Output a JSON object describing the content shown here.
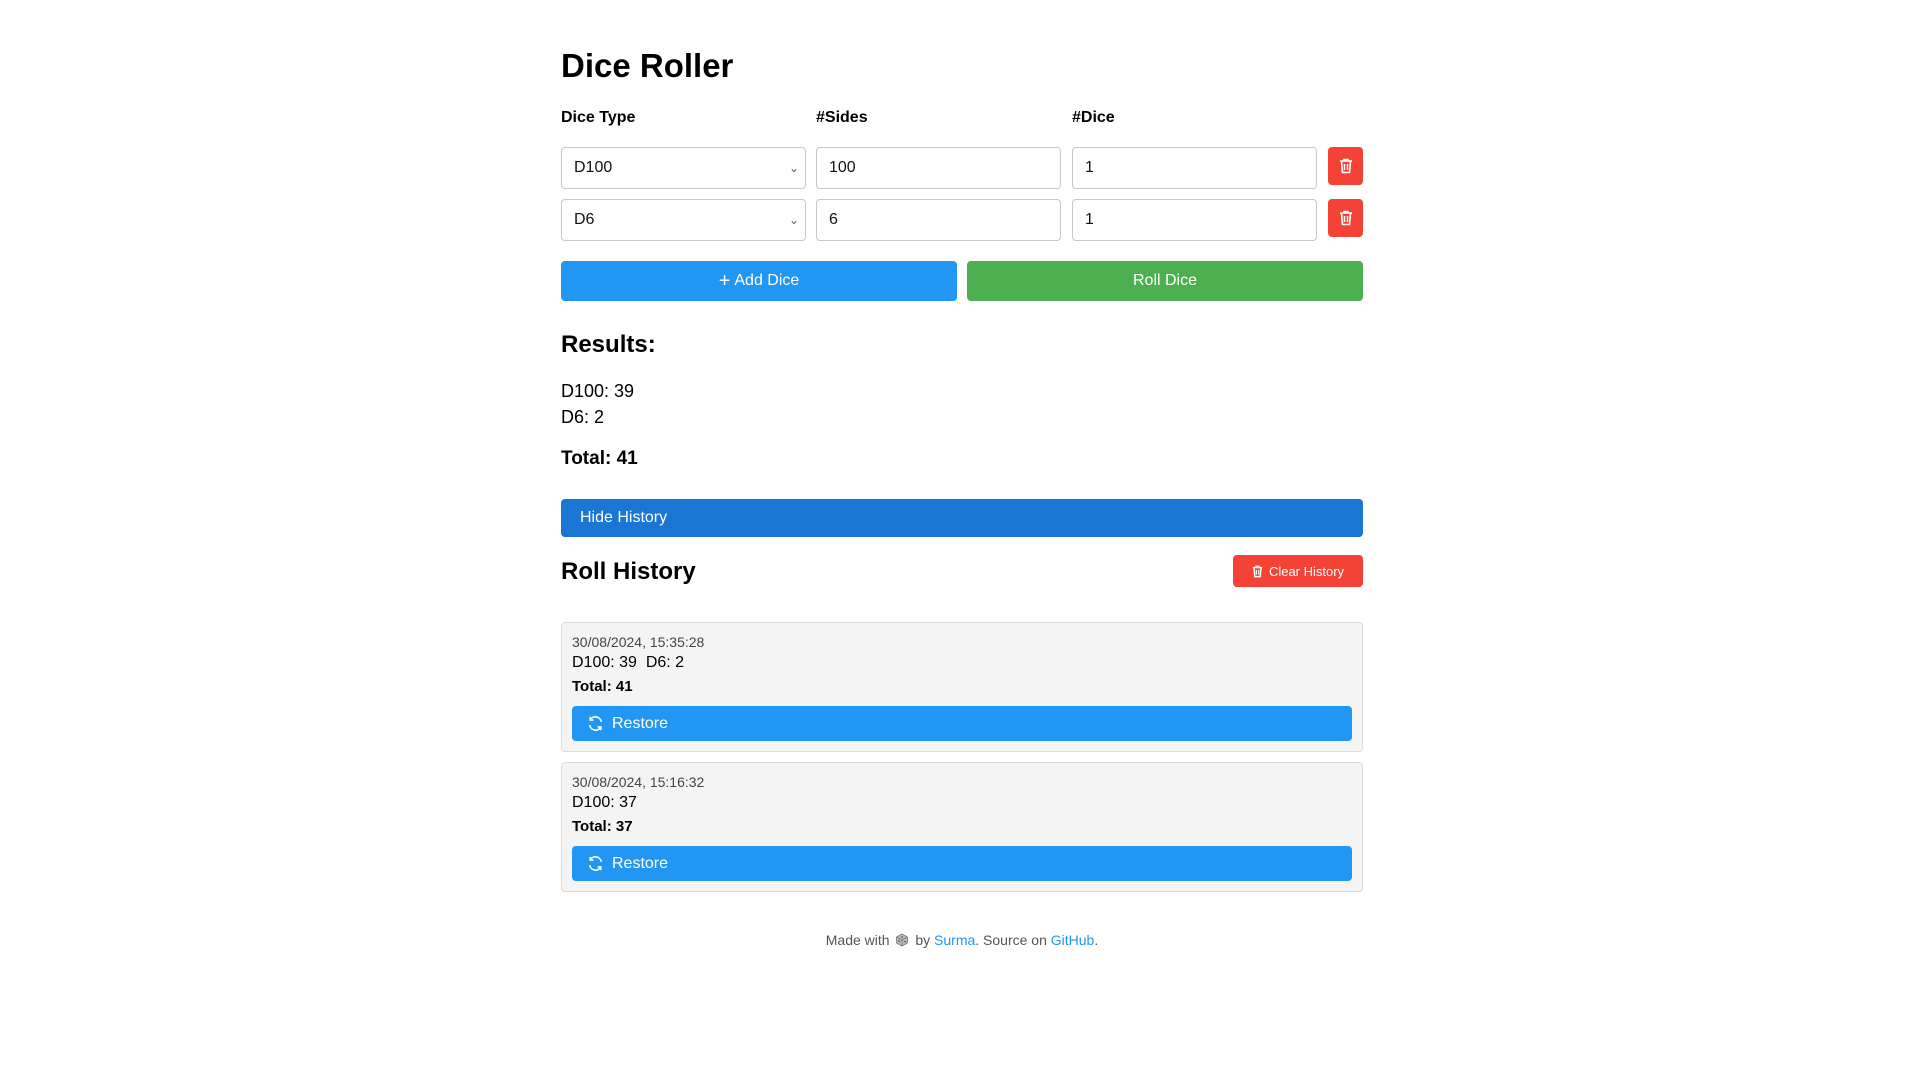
{
  "app": {
    "title": "Dice Roller"
  },
  "columns": {
    "dice_type": "Dice Type",
    "sides": "#Sides",
    "dice": "#Dice"
  },
  "dice_rows": [
    {
      "type": "D100",
      "sides": "100",
      "count": "1"
    },
    {
      "type": "D6",
      "sides": "6",
      "count": "1"
    }
  ],
  "actions": {
    "add_plus": "+",
    "add_label": "Add Dice",
    "roll_label": "Roll Dice",
    "hide_history": "Hide History",
    "clear_history": "Clear History"
  },
  "results": {
    "heading": "Results:",
    "lines": [
      "D100: 39",
      "D6: 2"
    ],
    "total": "Total: 41"
  },
  "history": {
    "heading": "Roll History",
    "restore_label": "Restore",
    "entries": [
      {
        "timestamp": "30/08/2024, 15:35:28",
        "values": "D100: 39  D6: 2",
        "total": "Total: 41"
      },
      {
        "timestamp": "30/08/2024, 15:16:32",
        "values": "D100: 37",
        "total": "Total: 37"
      }
    ]
  },
  "footer": {
    "made_with": "Made with",
    "by": "by",
    "author": "Surma",
    "source_on": ". Source on",
    "github": "GitHub",
    "end": "."
  },
  "icons": {
    "delete": "trash-icon",
    "restore": "refresh-icon",
    "clear": "trash-icon",
    "footer": "dice-icon"
  },
  "colors": {
    "blue": "#2196f3",
    "dark_blue": "#1976d2",
    "green": "#4caf50",
    "red": "#f44336"
  }
}
